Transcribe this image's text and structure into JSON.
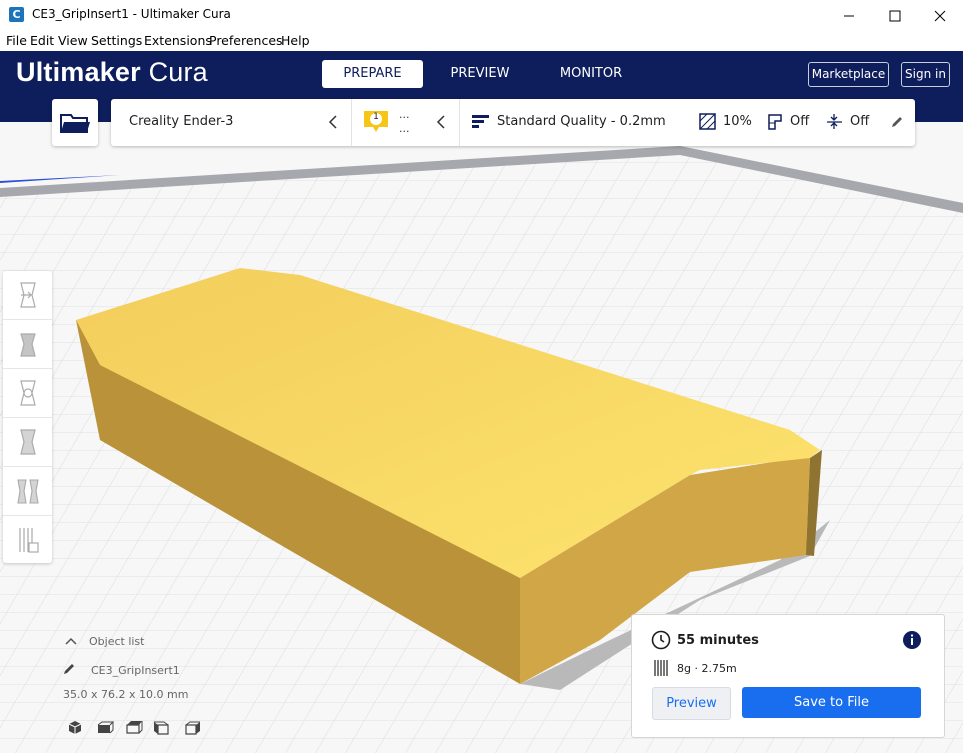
{
  "window": {
    "title": "CE3_GripInsert1 - Ultimaker Cura",
    "icon_letter": "C"
  },
  "menu": [
    "File",
    "Edit",
    "View",
    "Settings",
    "Extensions",
    "Preferences",
    "Help"
  ],
  "header": {
    "brand_bold": "Ultimaker",
    "brand_light": "Cura",
    "tabs": [
      {
        "label": "PREPARE",
        "active": true
      },
      {
        "label": "PREVIEW",
        "active": false
      },
      {
        "label": "MONITOR",
        "active": false
      }
    ],
    "marketplace": "Marketplace",
    "sign_in": "Sign in"
  },
  "stagebar": {
    "printer": "Creality Ender-3",
    "extruder_badge": "1",
    "extruder_line1": "...",
    "extruder_line2": "...",
    "quality": "Standard Quality - 0.2mm",
    "infill": "10%",
    "support": "Off",
    "adhesion": "Off"
  },
  "tools": [
    "move-icon",
    "scale-icon",
    "rotate-icon",
    "mirror-icon",
    "per-model-settings-icon",
    "support-blocker-icon"
  ],
  "object": {
    "list_label": "Object list",
    "name": "CE3_GripInsert1",
    "dimensions": "35.0 x 76.2 x 10.0 mm"
  },
  "print": {
    "time": "55 minutes",
    "material": "8g · 2.75m",
    "preview_label": "Preview",
    "save_label": "Save to File"
  },
  "colors": {
    "header": "#0e1d5b",
    "accent": "#196ef0",
    "model": "#f6d266"
  }
}
